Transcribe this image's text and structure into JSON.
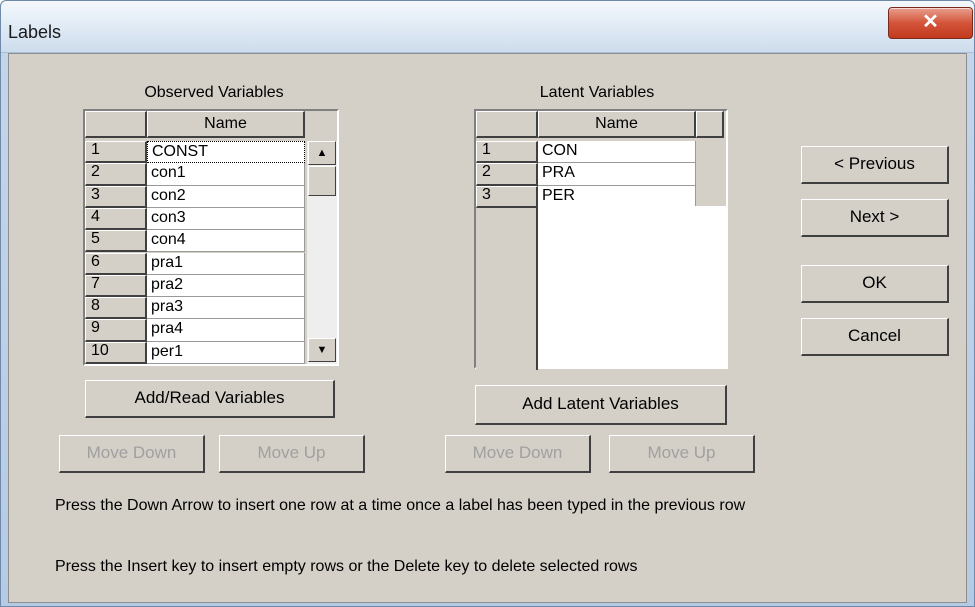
{
  "window": {
    "title": "Labels",
    "close_glyph": "✕"
  },
  "observed": {
    "heading": "Observed Variables",
    "column_header": "Name",
    "rows": [
      {
        "num": "1",
        "name": "CONST"
      },
      {
        "num": "2",
        "name": "con1"
      },
      {
        "num": "3",
        "name": "con2"
      },
      {
        "num": "4",
        "name": "con3"
      },
      {
        "num": "5",
        "name": "con4"
      },
      {
        "num": "6",
        "name": "pra1"
      },
      {
        "num": "7",
        "name": "pra2"
      },
      {
        "num": "8",
        "name": "pra3"
      },
      {
        "num": "9",
        "name": "pra4"
      },
      {
        "num": "10",
        "name": "per1"
      }
    ],
    "add_button": "Add/Read Variables",
    "move_down": "Move Down",
    "move_up": "Move Up"
  },
  "latent": {
    "heading": "Latent Variables",
    "column_header": "Name",
    "rows": [
      {
        "num": "1",
        "name": "CON"
      },
      {
        "num": "2",
        "name": "PRA"
      },
      {
        "num": "3",
        "name": "PER"
      }
    ],
    "add_button": "Add Latent Variables",
    "move_down": "Move Down",
    "move_up": "Move Up"
  },
  "nav": {
    "previous": "< Previous",
    "next": "Next >",
    "ok": "OK",
    "cancel": "Cancel"
  },
  "hints": {
    "line1": "Press the Down Arrow to insert one row at a time once a label has been typed in the previous row",
    "line2": "Press the Insert key to insert empty rows or the Delete key to delete selected rows"
  },
  "scroll": {
    "up_glyph": "▲",
    "down_glyph": "▼"
  }
}
